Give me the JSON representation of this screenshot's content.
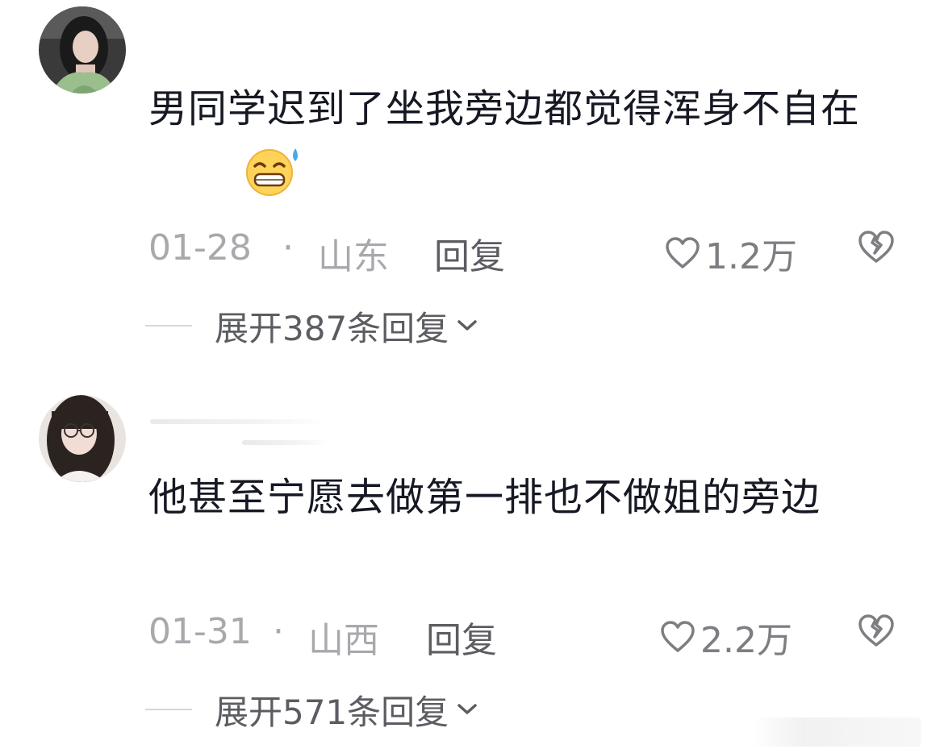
{
  "comments": [
    {
      "text": "男同学迟到了坐我旁边都觉得浑身不自在",
      "emoji": "sweat-smile-emoji",
      "date": "01-28",
      "separator": "·",
      "region": "山东",
      "reply_label": "回复",
      "likes": "1.2万",
      "expand_label": "展开387条回复",
      "icons": {
        "like": "heart-outline-icon",
        "dislike": "broken-heart-icon",
        "expand": "chevron-down-icon"
      }
    },
    {
      "text": "他甚至宁愿去做第一排也不做姐的旁边",
      "date": "01-31",
      "separator": "·",
      "region": "山西",
      "reply_label": "回复",
      "likes": "2.2万",
      "expand_label": "展开571条回复",
      "icons": {
        "like": "heart-outline-icon",
        "dislike": "broken-heart-icon",
        "expand": "chevron-down-icon"
      }
    }
  ],
  "colors": {
    "text_primary": "#161823",
    "text_meta": "#a8a9ad",
    "text_action": "#5c5d62",
    "divider": "#d8d8da"
  }
}
